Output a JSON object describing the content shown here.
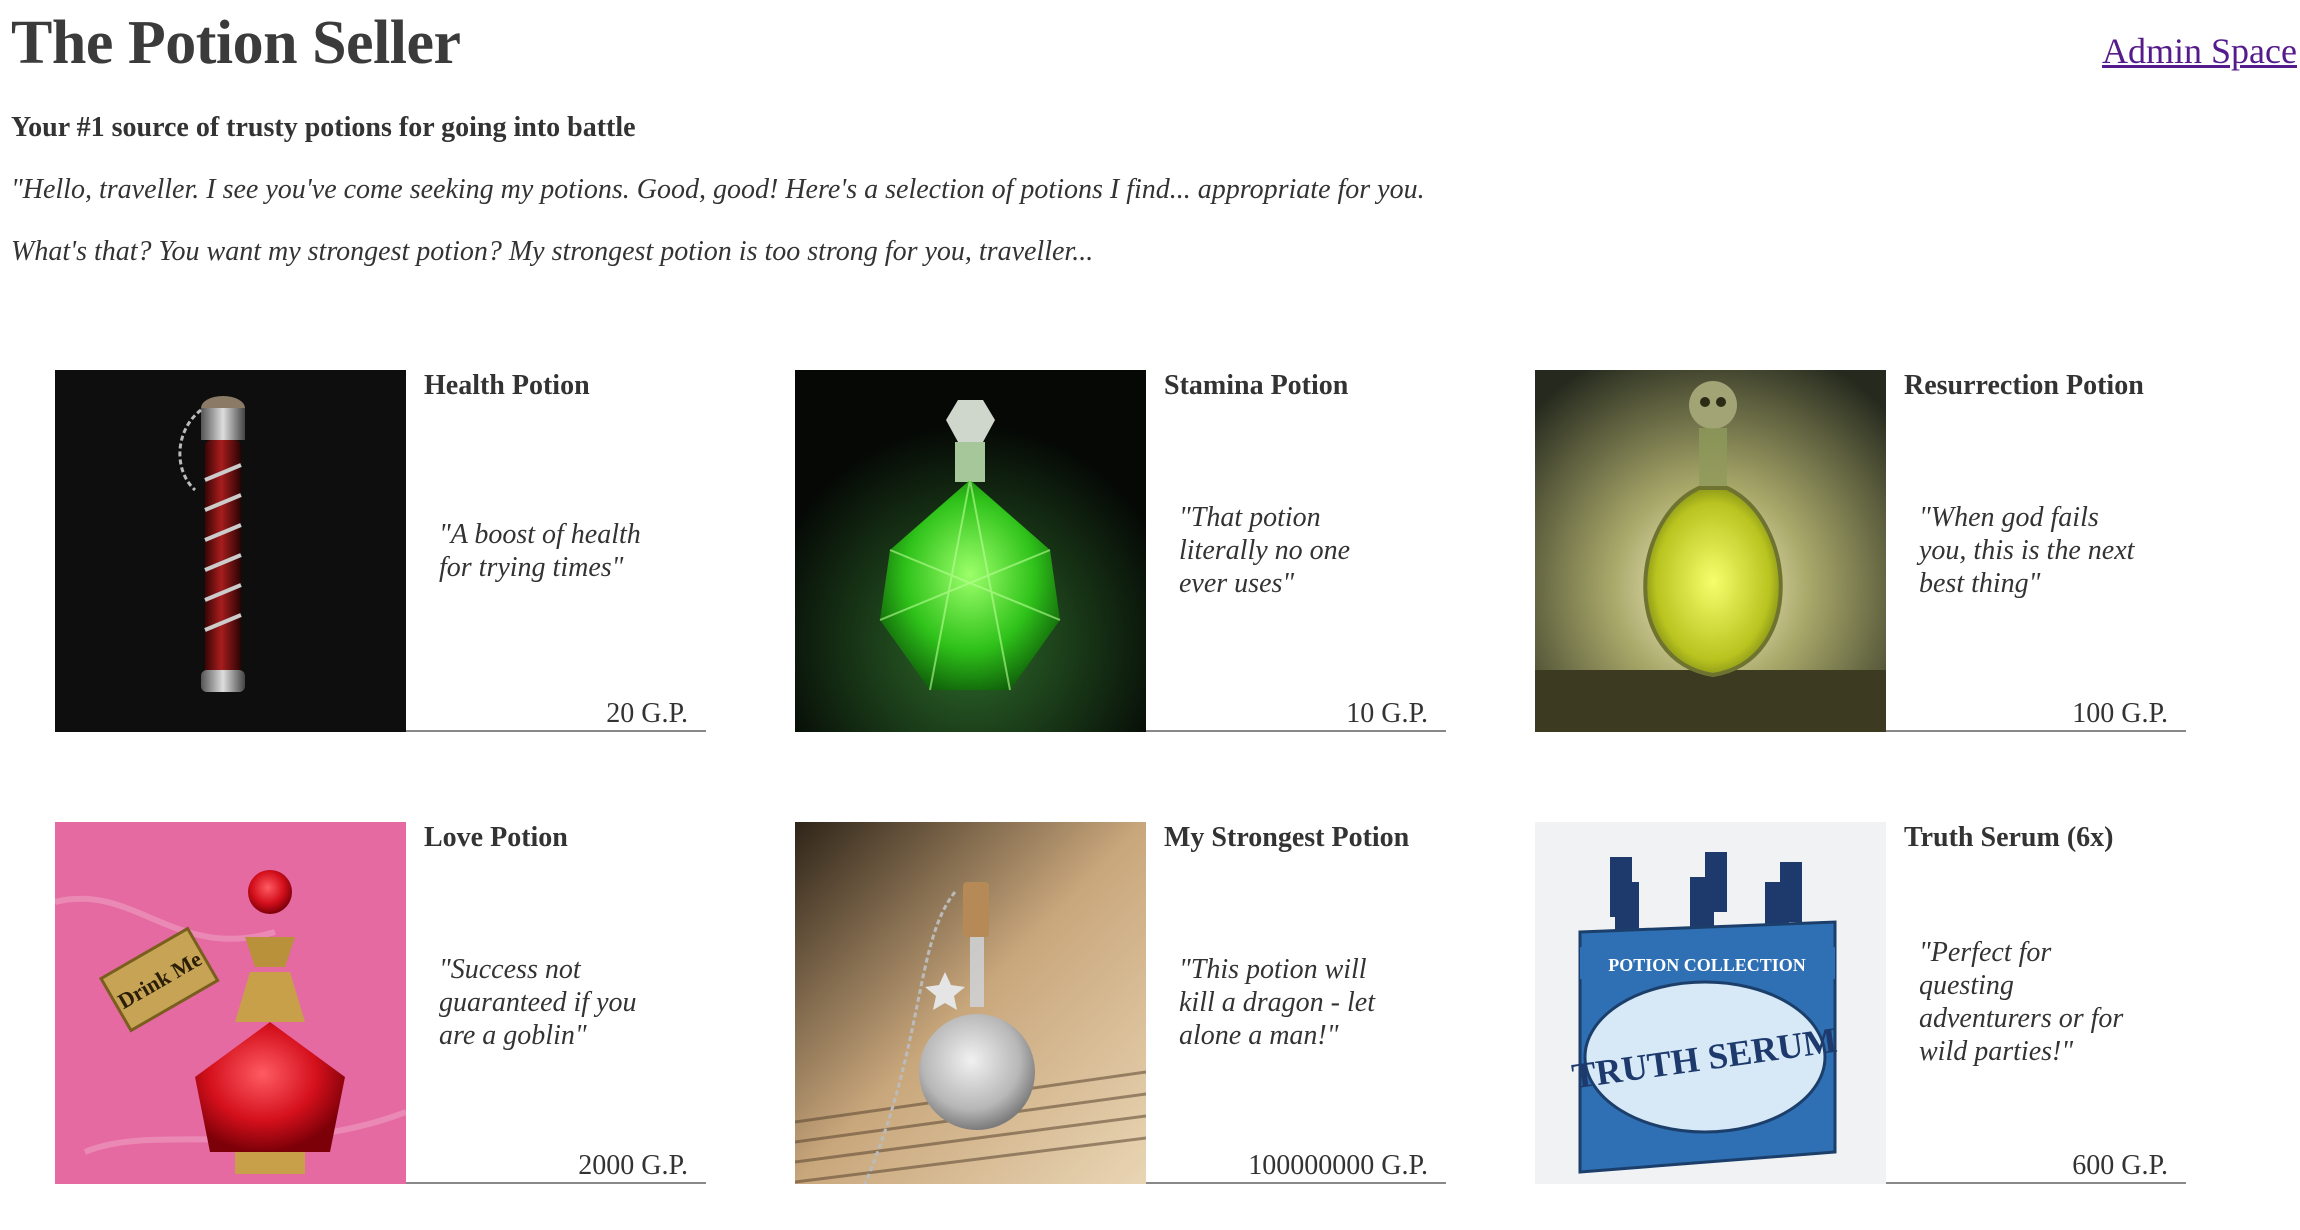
{
  "header": {
    "title": "The Potion Seller",
    "admin_link": "Admin Space",
    "tagline": "Your #1 source of trusty potions for going into battle",
    "intro_1": "\"Hello, traveller. I see you've come seeking my potions. Good, good! Here's a selection of potions I find... appropriate for you.",
    "intro_2": "What's that? You want my strongest potion? My strongest potion is too strong for you, traveller..."
  },
  "products": [
    {
      "name": "Health Potion",
      "quote": "\"A boost of health for trying times\"",
      "price": "20 G.P.",
      "image_icon": "red-vial-icon"
    },
    {
      "name": "Stamina Potion",
      "quote": "\"That potion literally no one ever uses\"",
      "price": "10 G.P.",
      "image_icon": "green-crystal-bottle-icon"
    },
    {
      "name": "Resurrection Potion",
      "quote": "\"When god fails you, this is the next best thing\"",
      "price": "100 G.P.",
      "image_icon": "skull-flask-icon"
    },
    {
      "name": "Love Potion",
      "quote": "\"Success not guaranteed if you are a goblin\"",
      "price": "2000 G.P.",
      "image_icon": "drink-me-bottle-icon",
      "image_label": "Drink Me"
    },
    {
      "name": "My Strongest Potion",
      "quote": "\"This potion will kill a dragon - let alone a man!\"",
      "price": "100000000 G.P.",
      "image_icon": "glitter-vial-icon"
    },
    {
      "name": "Truth Serum (6x)",
      "quote": "\"Perfect for questing adventurers or for wild parties!\"",
      "price": "600 G.P.",
      "image_icon": "six-pack-icon",
      "image_label": "TRUTH SERUM",
      "image_banner": "POTION COLLECTION"
    }
  ]
}
